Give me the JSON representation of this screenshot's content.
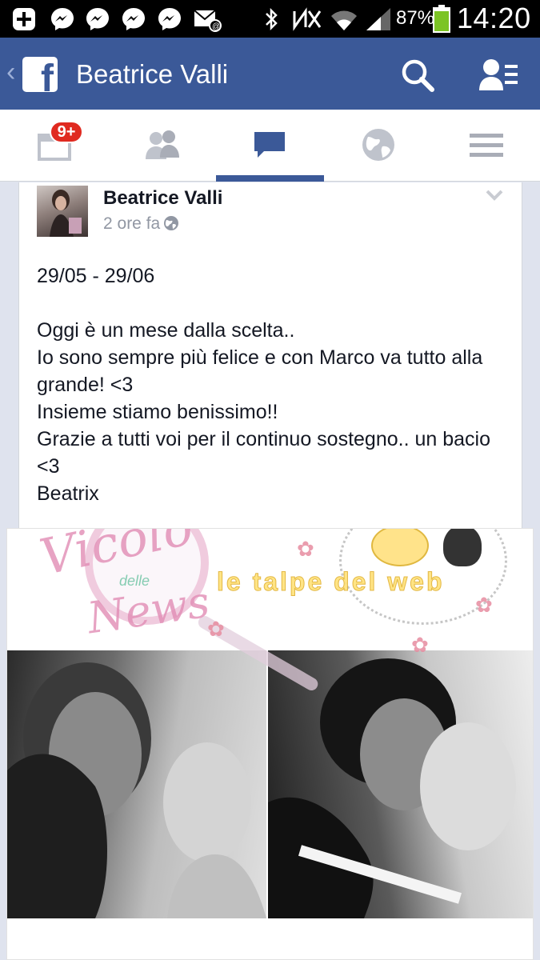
{
  "status_bar": {
    "battery_percent": "87%",
    "time": "14:20"
  },
  "header": {
    "title": "Beatrice Valli"
  },
  "tabs": {
    "notifications_badge": "9+",
    "active_tab": "messages"
  },
  "post": {
    "author": "Beatrice Valli",
    "timestamp": "2 ore fa",
    "date_line": "29/05 - 29/06",
    "body": "Oggi è un mese dalla scelta..\nIo sono sempre più felice e con Marco va tutto alla grande! <3\nInsieme stiamo benissimo!!\nGrazie a tutti voi per il continuo sostegno.. un bacio <3\nBeatrix"
  },
  "photo": {
    "watermark_vicolo": "Vicolo",
    "watermark_delle": "delle",
    "watermark_news": "News",
    "watermark_talpe": "le talpe del web"
  },
  "colors": {
    "facebook_blue": "#3b5998",
    "badge_red": "#e02a20",
    "battery_green": "#7cc425"
  }
}
